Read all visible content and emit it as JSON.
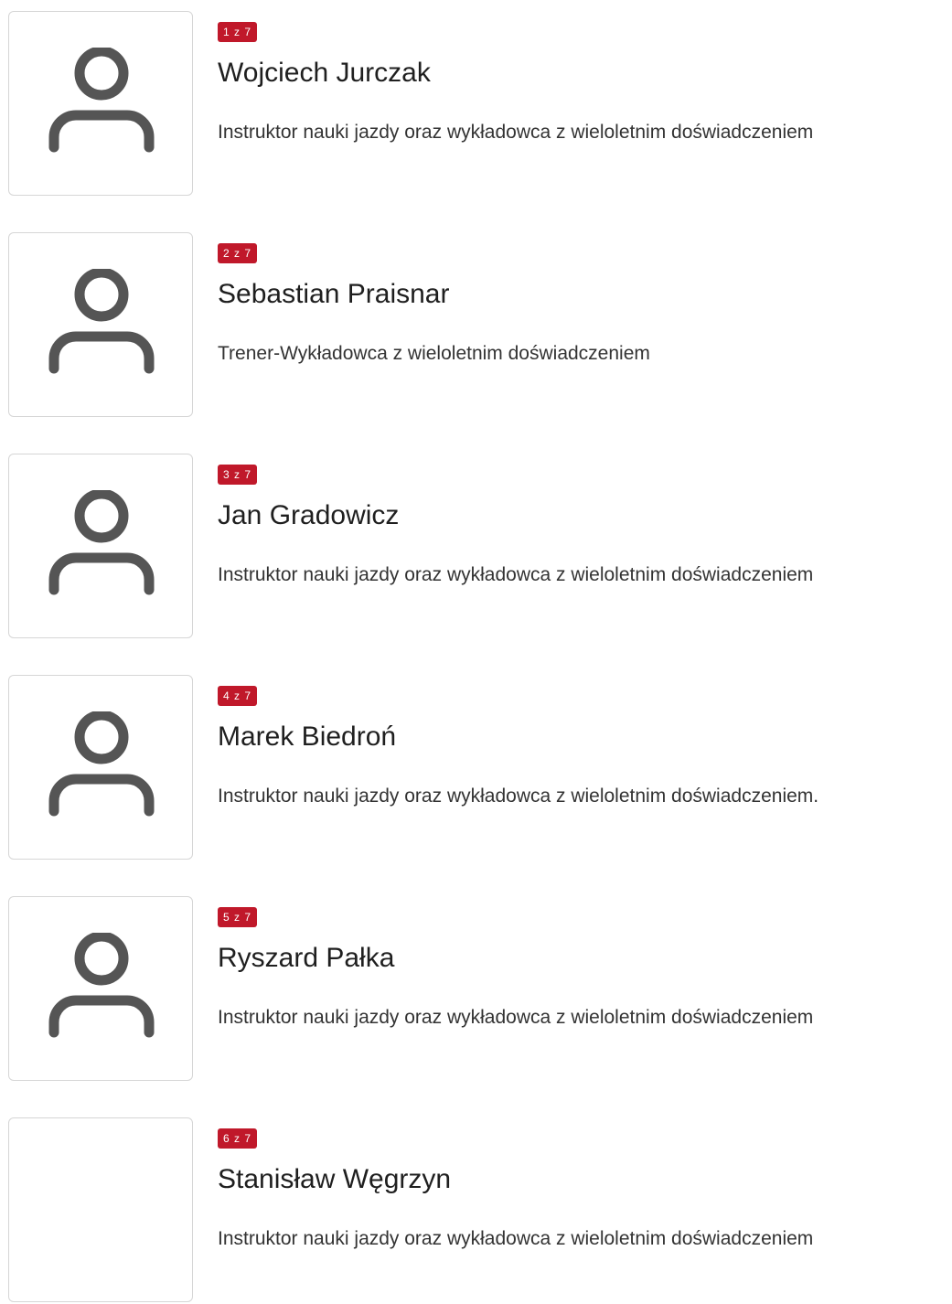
{
  "instructors": [
    {
      "badge": "1 z 7",
      "name": "Wojciech Jurczak",
      "description": "Instruktor nauki jazdy oraz wykładowca z wieloletnim doświadczeniem",
      "avatar_icon": "user-silhouette-icon"
    },
    {
      "badge": "2 z 7",
      "name": "Sebastian Praisnar",
      "description": "Trener-Wykładowca z wieloletnim doświadczeniem",
      "avatar_icon": "user-silhouette-icon"
    },
    {
      "badge": "3 z 7",
      "name": "Jan Gradowicz",
      "description": "Instruktor nauki jazdy oraz wykładowca z wieloletnim doświadczeniem",
      "avatar_icon": "user-silhouette-icon"
    },
    {
      "badge": "4 z 7",
      "name": "Marek Biedroń",
      "description": "Instruktor nauki jazdy oraz wykładowca z wieloletnim doświadczeniem.",
      "avatar_icon": "user-silhouette-icon"
    },
    {
      "badge": "5 z 7",
      "name": "Ryszard Pałka",
      "description": "Instruktor nauki jazdy oraz wykładowca z wieloletnim doświadczeniem",
      "avatar_icon": "user-silhouette-icon"
    },
    {
      "badge": "6 z 7",
      "name": "Stanisław Węgrzyn",
      "description": "Instruktor nauki jazdy oraz wykładowca z wieloletnim doświadczeniem",
      "avatar_icon": ""
    }
  ],
  "colors": {
    "badge_background": "#c0182a",
    "avatar_icon": "#555555"
  }
}
